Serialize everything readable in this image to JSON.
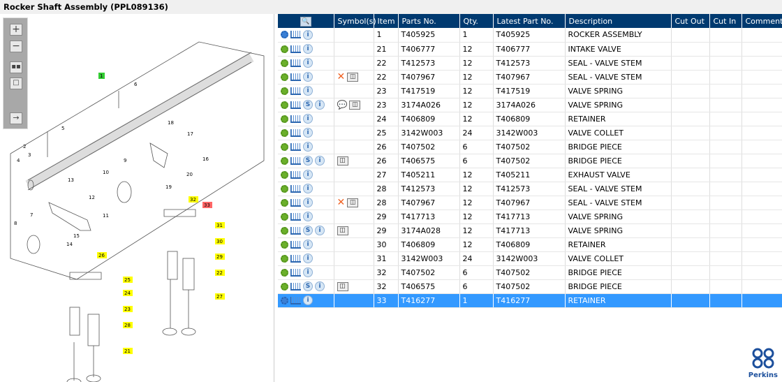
{
  "title": "Rocker Shaft Assembly (PPL089136)",
  "toolbar": {
    "zoom_in": "zoom-in",
    "zoom_out": "zoom-out",
    "fit": "fit",
    "window": "window",
    "export": "export"
  },
  "diagram": {
    "callouts": [
      "1",
      "6",
      "5",
      "2",
      "3",
      "4",
      "18",
      "17",
      "16",
      "9",
      "10",
      "13",
      "12",
      "11",
      "8",
      "7",
      "15",
      "14",
      "19",
      "20",
      "32",
      "33",
      "31",
      "30",
      "29",
      "22",
      "27",
      "26",
      "25",
      "24",
      "23",
      "28",
      "21"
    ],
    "highlight_color": "#ffff00",
    "selected_color": "#ff6666",
    "green_marker": "#33cc33"
  },
  "grid": {
    "headers": [
      "Symbol(s)",
      "Item",
      "Parts No.",
      "Qty.",
      "Latest Part No.",
      "Description",
      "Cut Out",
      "Cut In",
      "Comment"
    ],
    "rows": [
      {
        "gear": "blue",
        "s": false,
        "sym": "",
        "item": "1",
        "part": "T405925",
        "qty": "1",
        "latest": "T405925",
        "desc": "ROCKER ASSEMBLY"
      },
      {
        "gear": "green",
        "s": false,
        "sym": "",
        "item": "21",
        "part": "T406777",
        "qty": "12",
        "latest": "T406777",
        "desc": "INTAKE VALVE"
      },
      {
        "gear": "green",
        "s": false,
        "sym": "",
        "item": "22",
        "part": "T412573",
        "qty": "12",
        "latest": "T412573",
        "desc": "SEAL - VALVE STEM"
      },
      {
        "gear": "green",
        "s": false,
        "sym": "x-book",
        "item": "22",
        "part": "T407967",
        "qty": "12",
        "latest": "T407967",
        "desc": "SEAL - VALVE STEM"
      },
      {
        "gear": "green",
        "s": false,
        "sym": "",
        "item": "23",
        "part": "T417519",
        "qty": "12",
        "latest": "T417519",
        "desc": "VALVE SPRING"
      },
      {
        "gear": "green",
        "s": true,
        "sym": "bubble-book",
        "item": "23",
        "part": "3174A026",
        "qty": "12",
        "latest": "3174A026",
        "desc": "VALVE SPRING"
      },
      {
        "gear": "green",
        "s": false,
        "sym": "",
        "item": "24",
        "part": "T406809",
        "qty": "12",
        "latest": "T406809",
        "desc": "RETAINER"
      },
      {
        "gear": "green",
        "s": false,
        "sym": "",
        "item": "25",
        "part": "3142W003",
        "qty": "24",
        "latest": "3142W003",
        "desc": "VALVE COLLET"
      },
      {
        "gear": "green",
        "s": false,
        "sym": "",
        "item": "26",
        "part": "T407502",
        "qty": "6",
        "latest": "T407502",
        "desc": "BRIDGE PIECE"
      },
      {
        "gear": "green",
        "s": true,
        "sym": "book",
        "item": "26",
        "part": "T406575",
        "qty": "6",
        "latest": "T407502",
        "desc": "BRIDGE PIECE"
      },
      {
        "gear": "green",
        "s": false,
        "sym": "",
        "item": "27",
        "part": "T405211",
        "qty": "12",
        "latest": "T405211",
        "desc": "EXHAUST VALVE"
      },
      {
        "gear": "green",
        "s": false,
        "sym": "",
        "item": "28",
        "part": "T412573",
        "qty": "12",
        "latest": "T412573",
        "desc": "SEAL - VALVE STEM"
      },
      {
        "gear": "green",
        "s": false,
        "sym": "x-book",
        "item": "28",
        "part": "T407967",
        "qty": "12",
        "latest": "T407967",
        "desc": "SEAL - VALVE STEM"
      },
      {
        "gear": "green",
        "s": false,
        "sym": "",
        "item": "29",
        "part": "T417713",
        "qty": "12",
        "latest": "T417713",
        "desc": "VALVE SPRING"
      },
      {
        "gear": "green",
        "s": true,
        "sym": "book",
        "item": "29",
        "part": "3174A028",
        "qty": "12",
        "latest": "T417713",
        "desc": "VALVE SPRING"
      },
      {
        "gear": "green",
        "s": false,
        "sym": "",
        "item": "30",
        "part": "T406809",
        "qty": "12",
        "latest": "T406809",
        "desc": "RETAINER"
      },
      {
        "gear": "green",
        "s": false,
        "sym": "",
        "item": "31",
        "part": "3142W003",
        "qty": "24",
        "latest": "3142W003",
        "desc": "VALVE COLLET"
      },
      {
        "gear": "green",
        "s": false,
        "sym": "",
        "item": "32",
        "part": "T407502",
        "qty": "6",
        "latest": "T407502",
        "desc": "BRIDGE PIECE"
      },
      {
        "gear": "green",
        "s": true,
        "sym": "book",
        "item": "32",
        "part": "T406575",
        "qty": "6",
        "latest": "T407502",
        "desc": "BRIDGE PIECE"
      },
      {
        "gear": "blue",
        "s": false,
        "sym": "",
        "item": "33",
        "part": "T416277",
        "qty": "1",
        "latest": "T416277",
        "desc": "RETAINER",
        "selected": true
      }
    ]
  },
  "logo": {
    "text": "Perkins",
    "color": "#1c4f9c"
  },
  "colors": {
    "header": "#003a70",
    "selected": "#3399ff"
  }
}
